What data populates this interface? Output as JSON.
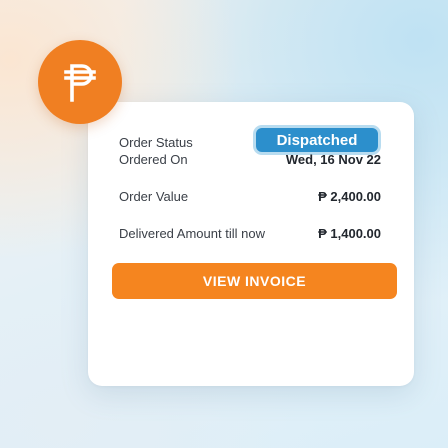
{
  "currency_symbol": "₱",
  "order": {
    "status_label": "Order Status",
    "status_value": "Dispatched",
    "ordered_on_label": "Ordered On",
    "ordered_on_value": "Wed, 16 Nov 22",
    "order_value_label": "Order Value",
    "order_value_value": "₱ 2,400.00",
    "delivered_label": "Delivered Amount till now",
    "delivered_value": "₱ 1,400.00"
  },
  "actions": {
    "view_invoice_label": "VIEW INVOICE"
  },
  "colors": {
    "accent_orange": "#f5851f",
    "status_blue": "#2c8fcc",
    "badge_orange": "#f07f22"
  },
  "icons": {
    "currency": "peso-icon"
  }
}
